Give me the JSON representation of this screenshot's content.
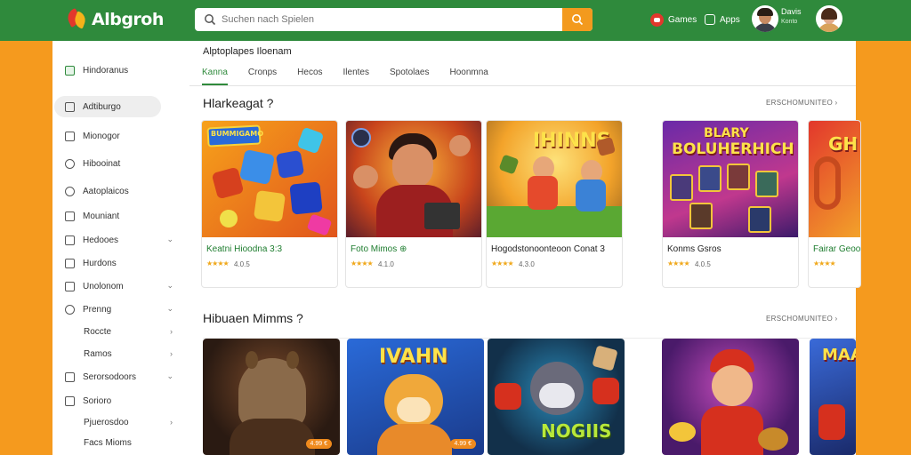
{
  "app": {
    "logo_text": "Albgroh",
    "search_placeholder": "Suchen nach Spielen",
    "nav_games": "Games",
    "nav_apps": "Apps",
    "user_name": "Davis",
    "user_sub": "Konto"
  },
  "sidebar": {
    "items": [
      {
        "label": "Hindoranus",
        "icon": "home-icon"
      },
      {
        "label": "Adtiburgo",
        "icon": "tag-icon"
      },
      {
        "label": "Mionogor",
        "icon": "square-icon"
      },
      {
        "label": "Hibooinat",
        "icon": "chat-icon"
      },
      {
        "label": "Aatoplaicos",
        "icon": "gear-icon"
      },
      {
        "label": "Mouniant",
        "icon": "list-icon"
      },
      {
        "label": "Hedooes",
        "icon": "grid-icon"
      },
      {
        "label": "Hurdons",
        "icon": "box-icon"
      },
      {
        "label": "Unolonom",
        "icon": "box-icon"
      },
      {
        "label": "Prenng",
        "icon": "chat-icon"
      },
      {
        "label": "Roccte",
        "icon": ""
      },
      {
        "label": "Ramos",
        "icon": ""
      },
      {
        "label": "Serorsodoors",
        "icon": "box-icon"
      },
      {
        "label": "Sorioro",
        "icon": "list-icon"
      },
      {
        "label": "Pjuerosdoo",
        "icon": ""
      },
      {
        "label": "Facs Mioms",
        "icon": ""
      }
    ]
  },
  "main": {
    "heading": "Alptoplapes Iloenam",
    "tabs": [
      "Kanna",
      "Cronps",
      "Hecos",
      "Ilentes",
      "Spotolaes",
      "Hoonmna"
    ],
    "section1": {
      "title": "Hlarkeagat ?",
      "see_more": "ERSCHOMUNITEO"
    },
    "section2": {
      "title": "Hibuaen Mimms ?",
      "see_more": "ERSCHOMUNITEO"
    },
    "cards": [
      {
        "title": "Keatni Hioodna 3:3",
        "stars": "★★★★",
        "rating": "4.0.5"
      },
      {
        "title": "Foto Mimos ⊕",
        "stars": "★★★★",
        "rating": "4.1.0"
      },
      {
        "title": "Hogodstonoonteoon Conat 3",
        "stars": "★★★★",
        "rating": "4.3.0"
      },
      {
        "title": "Konms Gsros",
        "stars": "★★★★",
        "rating": "4.0.5"
      },
      {
        "title": "Fairar Geoo",
        "stars": "★★★★",
        "rating": ""
      }
    ],
    "card_art_text": {
      "card1_banner": "BUMMIGAMO",
      "card3_word": "IHINNS",
      "card4_word1": "BLARY",
      "card4_word2": "BOLUHERHICH",
      "card5_word": "GH",
      "row2_card2_word": "IVAHN",
      "row2_card3_word": "NOGIIS",
      "row2_card5_word": "MAA"
    },
    "row2_prices": [
      "4.99 €",
      "4.99 €"
    ]
  }
}
